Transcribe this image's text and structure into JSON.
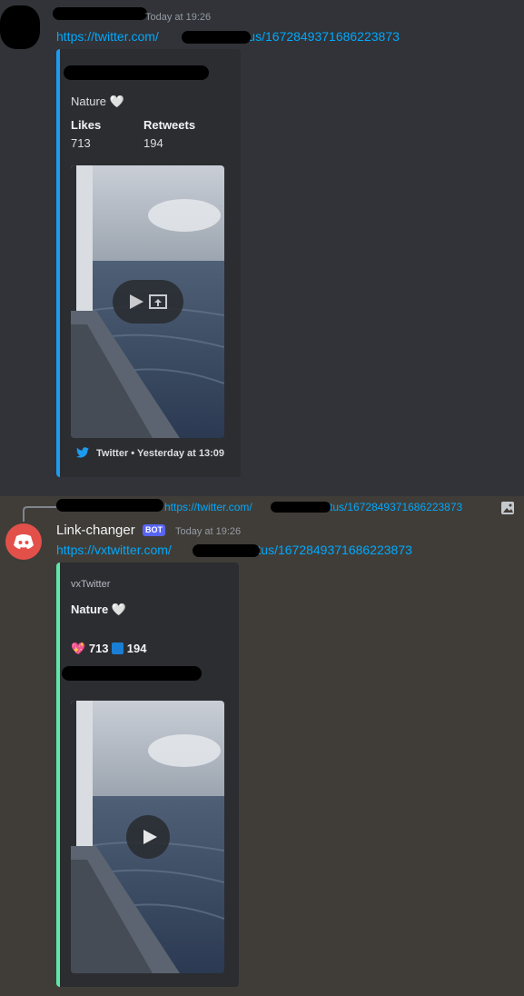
{
  "message1": {
    "timestamp": "Today at 19:26",
    "link_prefix": "https://twitter.com/",
    "link_suffix": "/status/1672849371686223873",
    "embed": {
      "description": "Nature 🤍",
      "fields": [
        {
          "name": "Likes",
          "value": "713"
        },
        {
          "name": "Retweets",
          "value": "194"
        }
      ],
      "footer_provider": "Twitter",
      "footer_time": "Yesterday at 13:09",
      "icons": {
        "video_play": "play-icon",
        "video_popout": "popout-icon",
        "footer": "twitter-bird-icon"
      }
    }
  },
  "message2": {
    "reply_link_prefix": "https://twitter.com/",
    "reply_link_suffix": "/status/1672849371686223873",
    "author": "Link-changer",
    "bot_badge": "BOT",
    "timestamp": "Today at 19:26",
    "link_prefix": "https://vxtwitter.com/",
    "link_suffix": "/status/1672849371686223873",
    "embed": {
      "provider": "vxTwitter",
      "title": "Nature 🤍",
      "likes_emoji": "💖",
      "likes": "713",
      "retweets_emoji": "🔁",
      "retweets": "194",
      "icons": {
        "avatar": "discord-logo-icon",
        "video_play": "play-icon",
        "reply_image": "image-icon"
      }
    }
  },
  "colors": {
    "link": "#00a8fc",
    "twitter_accent": "#1d9bf0",
    "vx_accent": "#5ee8a7",
    "bot_badge": "#5865f2",
    "avatar": "#e3504a"
  }
}
